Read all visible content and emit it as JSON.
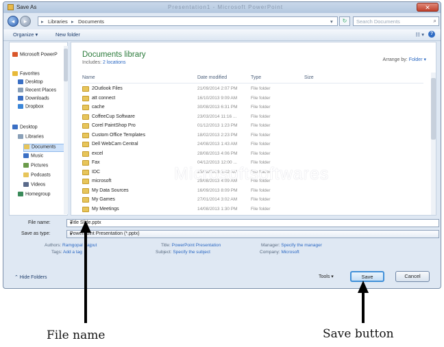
{
  "window": {
    "title": "Save As",
    "blurred_title": "Presentation1 - Microsoft PowerPoint",
    "close": "✕"
  },
  "address": {
    "crumbs": [
      "Libraries",
      "Documents"
    ],
    "search_placeholder": "Search Documents"
  },
  "toolbar": {
    "organize": "Organize ▾",
    "new_folder": "New folder",
    "view": "☷ ▾"
  },
  "nav": [
    {
      "label": "Microsoft PowerP",
      "color": "#d9572b",
      "indent": 0,
      "selected": false
    },
    {
      "label": "Favorites",
      "color": "#e7b93a",
      "indent": 0,
      "selected": false
    },
    {
      "label": "Desktop",
      "color": "#3a6fc4",
      "indent": 1,
      "selected": false
    },
    {
      "label": "Recent Places",
      "color": "#8aa0b8",
      "indent": 1,
      "selected": false
    },
    {
      "label": "Downloads",
      "color": "#3a6fc4",
      "indent": 1,
      "selected": false
    },
    {
      "label": "Dropbox",
      "color": "#3a86d8",
      "indent": 1,
      "selected": false
    },
    {
      "label": "Desktop",
      "color": "#3a6fc4",
      "indent": 0,
      "selected": false
    },
    {
      "label": "Libraries",
      "color": "#8aa0b8",
      "indent": 1,
      "selected": false
    },
    {
      "label": "Documents",
      "color": "#e7c55a",
      "indent": 2,
      "selected": true
    },
    {
      "label": "Music",
      "color": "#3a6fc4",
      "indent": 2,
      "selected": false
    },
    {
      "label": "Pictures",
      "color": "#6a9a4a",
      "indent": 2,
      "selected": false
    },
    {
      "label": "Podcasts",
      "color": "#e7c55a",
      "indent": 2,
      "selected": false
    },
    {
      "label": "Videos",
      "color": "#5a6a8a",
      "indent": 2,
      "selected": false
    },
    {
      "label": "Homegroup",
      "color": "#3a8a5a",
      "indent": 1,
      "selected": false
    }
  ],
  "library": {
    "title": "Documents library",
    "includes": "Includes:",
    "locations": "2 locations",
    "arrange_by": "Arrange by:",
    "arrange_value": "Folder ▾"
  },
  "columns": {
    "name": "Name",
    "date": "Date modified",
    "type": "Type",
    "size": "Size"
  },
  "files": [
    {
      "name": "2Outlook Files",
      "date": "21/09/2014 2:07 PM",
      "type": "File folder"
    },
    {
      "name": "att connect",
      "date": "16/10/2013 9:09 AM",
      "type": "File folder"
    },
    {
      "name": "cache",
      "date": "30/08/2013 6:31 PM",
      "type": "File folder"
    },
    {
      "name": "CoffeeCup Software",
      "date": "23/03/2014 11:16 ...",
      "type": "File folder"
    },
    {
      "name": "Corel PaintShop Pro",
      "date": "01/12/2013 1:23 PM",
      "type": "File folder"
    },
    {
      "name": "Custom Office Templates",
      "date": "18/02/2013 2:23 PM",
      "type": "File folder"
    },
    {
      "name": "Dell WebCam Central",
      "date": "24/08/2013 1:43 AM",
      "type": "File folder"
    },
    {
      "name": "excel",
      "date": "28/08/2013 4:06 PM",
      "type": "File folder"
    },
    {
      "name": "Fax",
      "date": "04/12/2013 12:00 ...",
      "type": "File folder"
    },
    {
      "name": "IDC",
      "date": "25/08/2013 3:42 AM",
      "type": "File folder"
    },
    {
      "name": "microsoft",
      "date": "29/08/2013 4:09 AM",
      "type": "File folder"
    },
    {
      "name": "My Data Sources",
      "date": "16/09/2013 8:09 PM",
      "type": "File folder"
    },
    {
      "name": "My Games",
      "date": "27/01/2014 3:02 AM",
      "type": "File folder"
    },
    {
      "name": "My Meetings",
      "date": "14/08/2013 1:30 PM",
      "type": "File folder"
    }
  ],
  "watermark": "Microsoftsoftwares",
  "file_name": {
    "label": "File name:",
    "value": "Title Slide.pptx"
  },
  "save_type": {
    "label": "Save as type:",
    "value": "PowerPoint Presentation (*.pptx)"
  },
  "metadata": {
    "authors_label": "Authors:",
    "authors_value": "Ramgopal Rajput",
    "tags_label": "Tags:",
    "tags_value": "Add a tag",
    "title_label": "Title:",
    "title_value": "PowerPoint Presentation",
    "subject_label": "Subject:",
    "subject_value": "Specify the subject",
    "manager_label": "Manager:",
    "manager_value": "Specify the manager",
    "company_label": "Company:",
    "company_value": "Microsoft"
  },
  "footer": {
    "hide_folders": "⌃ Hide Folders",
    "tools": "Tools ▾",
    "save": "Save",
    "cancel": "Cancel"
  },
  "annotations": {
    "file_name": "File name",
    "save_button": "Save button"
  }
}
